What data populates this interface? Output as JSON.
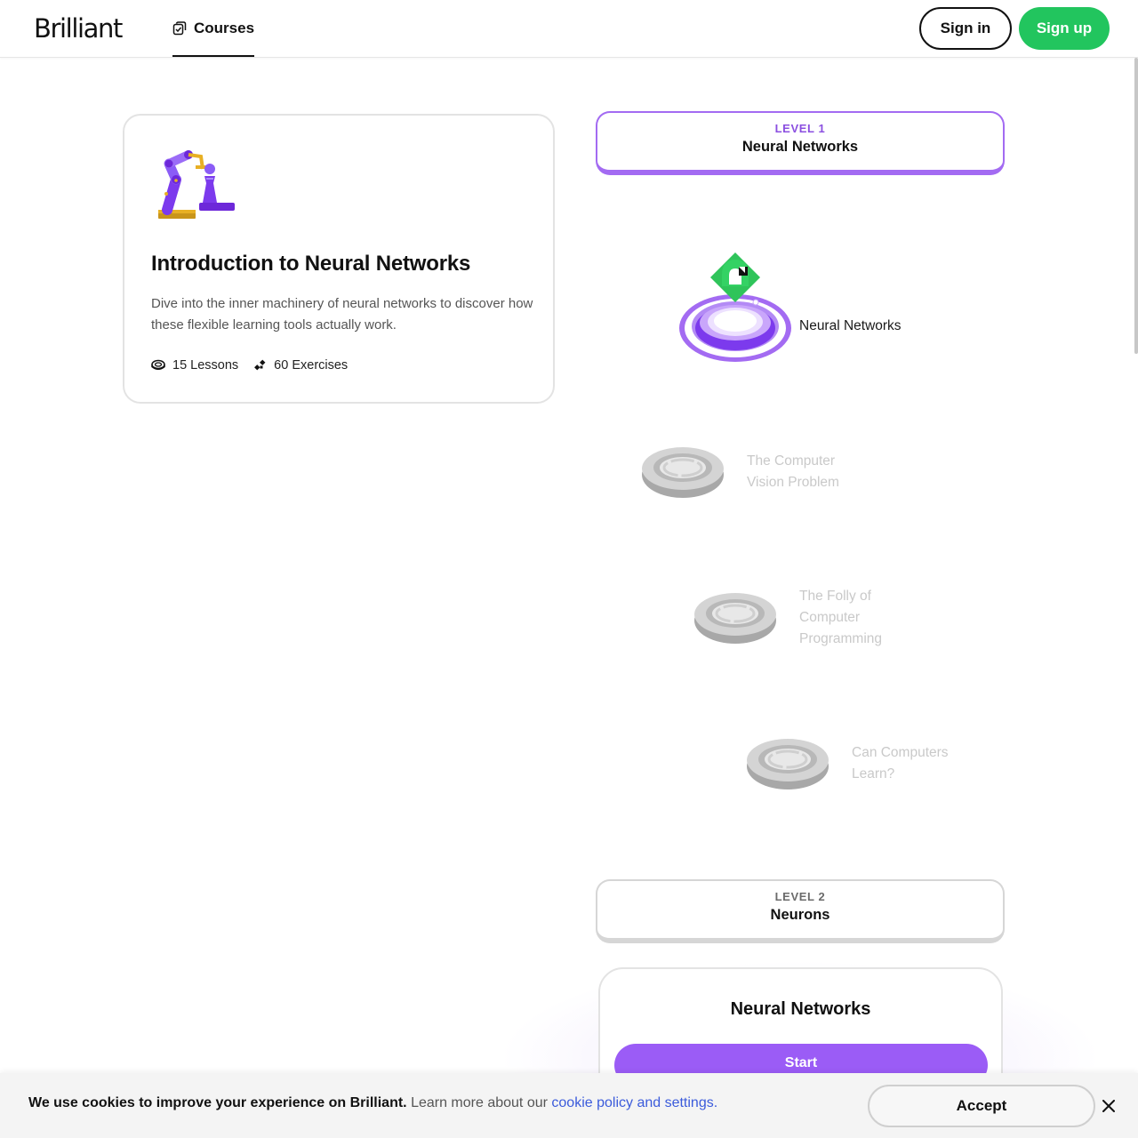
{
  "header": {
    "logo_text": "Brilliant",
    "nav": {
      "courses_label": "Courses",
      "courses_icon": "courses-icon"
    },
    "sign_in_label": "Sign in",
    "sign_up_label": "Sign up",
    "accent_color": "#22c55e"
  },
  "course": {
    "title": "Introduction to Neural Networks",
    "description": "Dive into the inner machinery of neural networks to discover how these flexible learning tools actually work.",
    "lessons_text": "15 Lessons",
    "exercises_text": "60 Exercises",
    "art_icon": "robot-arm-chess-icon"
  },
  "levels": [
    {
      "tag": "LEVEL 1",
      "name": "Neural Networks",
      "color": "#a36bf2"
    },
    {
      "tag": "LEVEL 2",
      "name": "Neurons",
      "color": "#d6d6d6"
    }
  ],
  "path": {
    "nodes": [
      {
        "label_lines": [
          "Neural Networks"
        ],
        "state": "current"
      },
      {
        "label_lines": [
          "The Computer",
          "Vision Problem"
        ],
        "state": "locked"
      },
      {
        "label_lines": [
          "The Folly of",
          "Computer",
          "Programming"
        ],
        "state": "locked"
      },
      {
        "label_lines": [
          "Can Computers",
          "Learn?"
        ],
        "state": "locked"
      }
    ]
  },
  "lesson_panel": {
    "title": "Neural Networks",
    "start_label": "Start",
    "button_color": "#9b5cf6"
  },
  "cookie": {
    "bold_text": "We use cookies to improve your experience on Brilliant.",
    "text": "Learn more about our",
    "link_text": "cookie policy and settings",
    "period": ".",
    "accept_label": "Accept"
  }
}
